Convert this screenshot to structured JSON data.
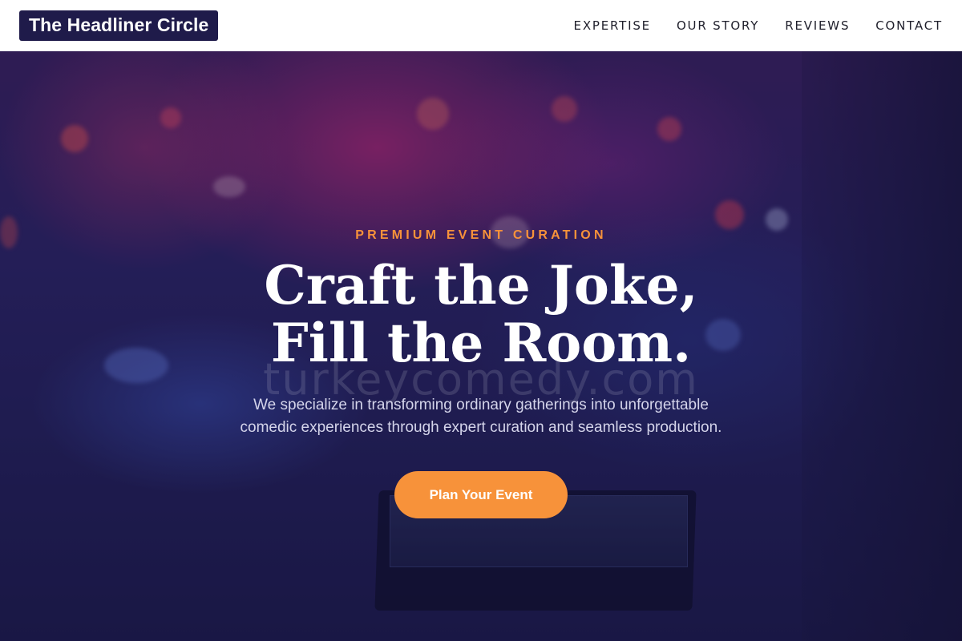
{
  "header": {
    "logo_text": "The Headliner Circle",
    "nav": [
      {
        "label": "EXPERTISE"
      },
      {
        "label": "OUR STORY"
      },
      {
        "label": "REVIEWS"
      },
      {
        "label": "CONTACT"
      }
    ]
  },
  "hero": {
    "eyebrow": "PREMIUM EVENT CURATION",
    "headline_line1": "Craft the Joke,",
    "headline_line2": "Fill the Room.",
    "watermark": "turkeycomedy.com",
    "description_line1": "We specialize in transforming ordinary gatherings into unforgettable",
    "description_line2": "comedic experiences through expert curation and seamless production.",
    "cta_label": "Plan Your Event"
  },
  "colors": {
    "accent": "#f7923a",
    "logo_bg": "#1f1b4a",
    "hero_bg": "#1c1a48"
  }
}
